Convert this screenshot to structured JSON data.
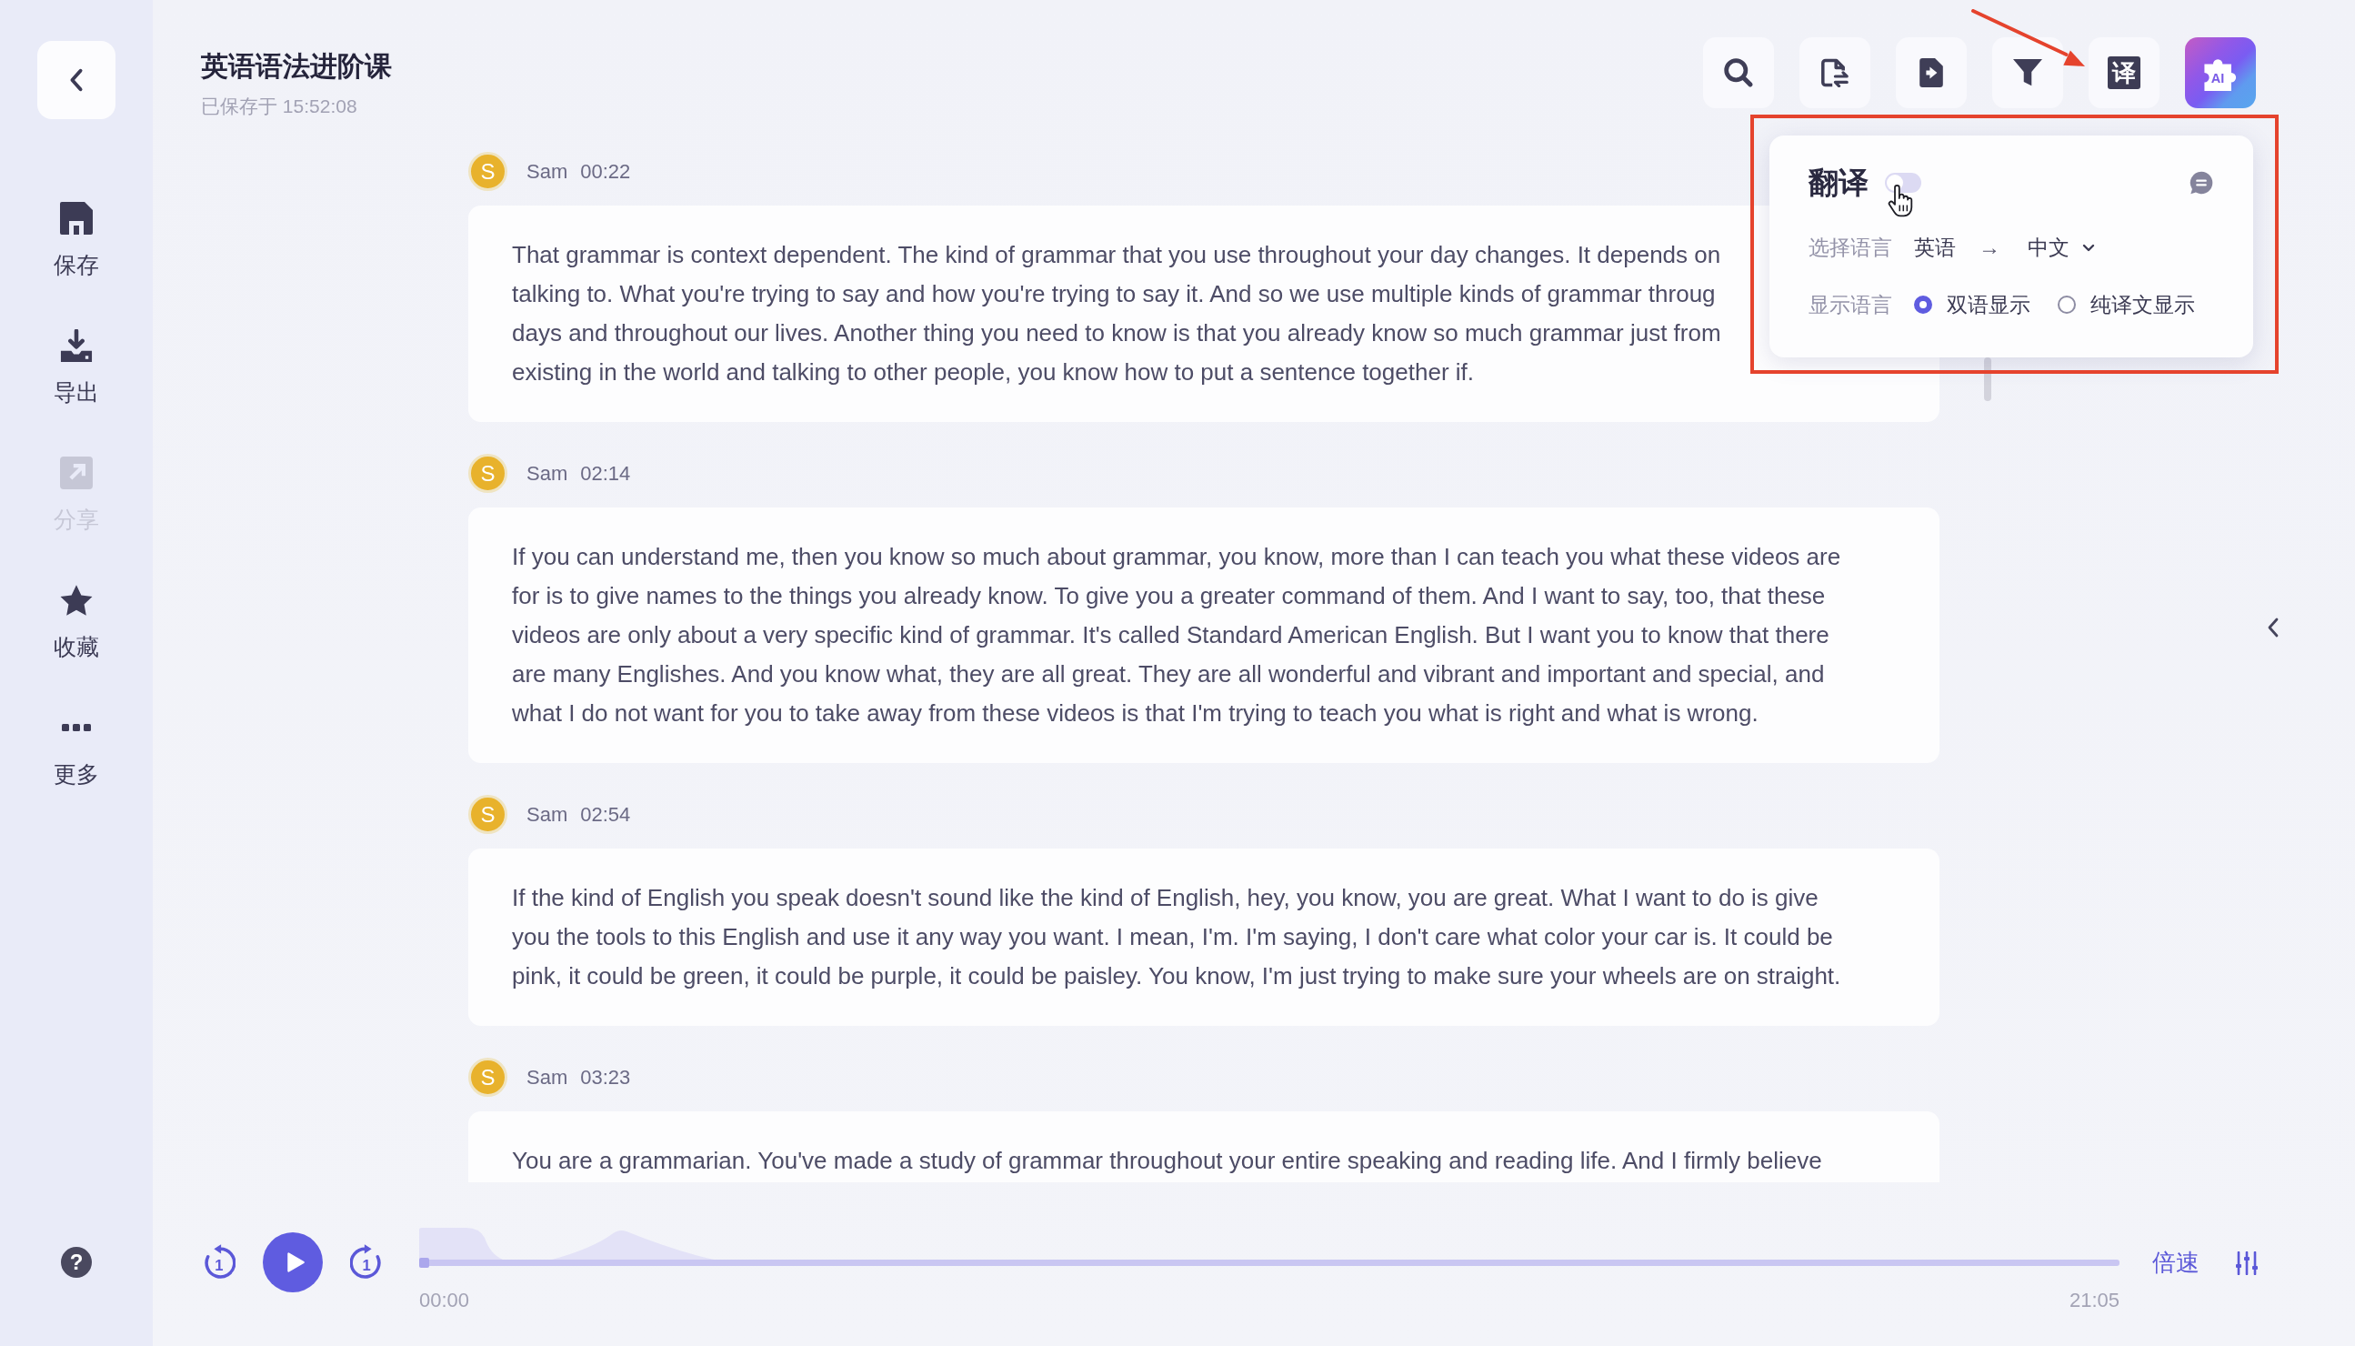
{
  "sidebar": {
    "items": [
      {
        "kind": "save",
        "label": "保存",
        "disabled": false
      },
      {
        "kind": "export",
        "label": "导出",
        "disabled": false
      },
      {
        "kind": "share",
        "label": "分享",
        "disabled": true
      },
      {
        "kind": "favorite",
        "label": "收藏",
        "disabled": false
      },
      {
        "kind": "more",
        "label": "更多",
        "disabled": false
      }
    ],
    "help": "?"
  },
  "document": {
    "title": "英语语法进阶课",
    "saved_status": "已保存于 15:52:08"
  },
  "toolbar": [
    {
      "kind": "search"
    },
    {
      "kind": "swap"
    },
    {
      "kind": "export"
    },
    {
      "kind": "filter"
    },
    {
      "kind": "translate",
      "label": "译"
    },
    {
      "kind": "ai",
      "label": "AI"
    }
  ],
  "transcript": [
    {
      "avatar": "S",
      "speaker": "Sam",
      "time": "00:22",
      "text": "That grammar is context dependent. The kind of grammar that you use throughout your day changes. It depends on\ntalking to. What you're trying to say and how you're trying to say it. And so we use multiple kinds of grammar throug\ndays and throughout our lives. Another thing you need to know is that you already know so much grammar just from\nexisting in the world and talking to other people, you know how to put a sentence together if."
    },
    {
      "avatar": "S",
      "speaker": "Sam",
      "time": "02:14",
      "text": "If you can understand me, then you know so much about grammar, you know, more than I can teach you what these videos are\nfor is to give names to the things you already know. To give you a greater command of them. And I want to say, too, that these\nvideos are only about a very specific kind of grammar. It's called Standard American English. But I want you to know that there\nare many Englishes. And you know what, they are all great. They are all wonderful and vibrant and important and special, and\nwhat I do not want for you to take away from these videos is that I'm trying to teach you what is right and what is wrong."
    },
    {
      "avatar": "S",
      "speaker": "Sam",
      "time": "02:54",
      "text": "If the kind of English you speak doesn't sound like the kind of English, hey, you know, you are great. What I want to do is give\nyou the tools to this English and use it any way you want. I mean, I'm. I'm saying, I don't care what color your car is. It could be\npink, it could be green, it could be purple, it could be paisley. You know, I'm just trying to make sure your wheels are on straight."
    },
    {
      "avatar": "S",
      "speaker": "Sam",
      "time": "03:23",
      "text": "You are a grammarian. You've made a study of grammar throughout your entire speaking and reading life. And I firmly believe"
    }
  ],
  "translate_popup": {
    "title": "翻译",
    "enabled": false,
    "language_label": "选择语言",
    "source_language": "英语",
    "arrow": "→",
    "target_language": "中文",
    "display_label": "显示语言",
    "display_options": [
      {
        "label": "双语显示",
        "selected": true
      },
      {
        "label": "纯译文显示",
        "selected": false
      }
    ]
  },
  "player": {
    "skip_back": "1",
    "skip_forward": "1",
    "progress": {
      "level": 0
    },
    "current_time": "00:00",
    "total_time": "21:05",
    "speed_label": "倍速"
  }
}
